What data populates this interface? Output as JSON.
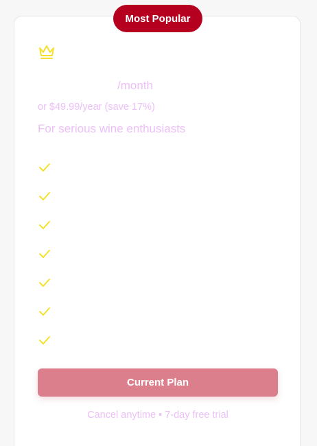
{
  "badge": {
    "label": "Most Popular"
  },
  "plan": {
    "price": "",
    "period": "/month",
    "yearly": "or $49.99/year (save 17%)",
    "tagline": "For serious wine enthusiasts"
  },
  "features": [
    "",
    "",
    "",
    "",
    "",
    "",
    ""
  ],
  "cta": {
    "label": "Current Plan"
  },
  "footer": {
    "note": "Cancel anytime • 7-day free trial"
  },
  "colors": {
    "badge_bg": "#b5001f",
    "accent_yellow": "#f5e02a",
    "muted_pink": "#ecbff7",
    "button_bg": "#dc7f8c"
  },
  "icons": {
    "plan": "crown-icon",
    "feature": "check-icon"
  }
}
